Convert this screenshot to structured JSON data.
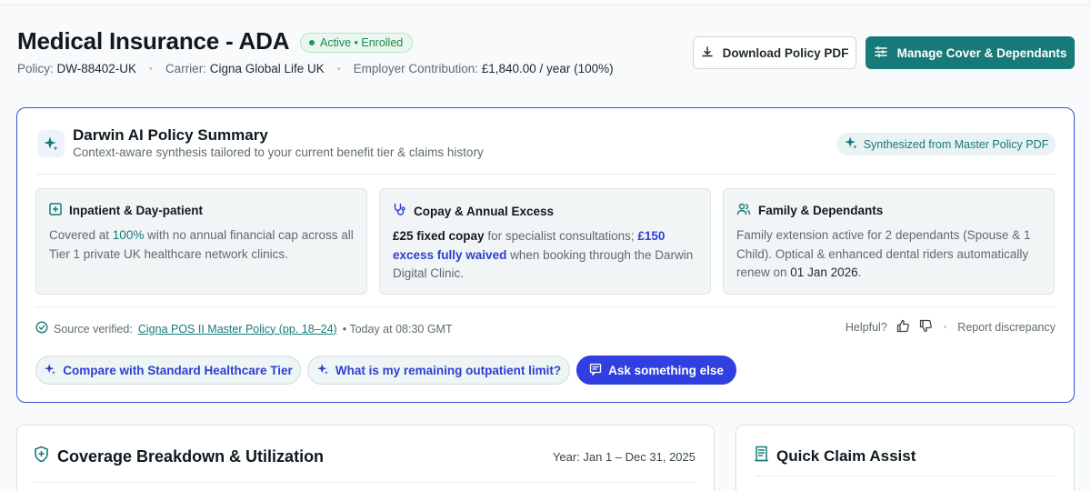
{
  "header": {
    "title": "Medical Insurance - ADA",
    "status": "Active • Enrolled",
    "policy_label": "Policy:",
    "policy_value": "DW-88402-UK",
    "carrier_label": "Carrier:",
    "carrier_value": "Cigna Global Life UK",
    "contribution_label": "Employer Contribution:",
    "contribution_value": "£1,840.00 / year (100%)",
    "download_button": "Download Policy PDF",
    "manage_button": "Manage Cover & Dependants"
  },
  "ai_summary": {
    "title": "Darwin AI Policy Summary",
    "subtitle": "Context-aware synthesis tailored to your current benefit tier & claims history",
    "source_badge": "Synthesized from Master Policy PDF",
    "cards": [
      {
        "title": "Inpatient & Day-patient",
        "icon": "plus-square-icon",
        "text_1": "Covered at ",
        "highlight": "100%",
        "text_2": " with no annual financial cap across all Tier 1 private UK healthcare network clinics."
      },
      {
        "title": "Copay & Annual Excess",
        "icon": "stethoscope-icon",
        "bold": "£25 fixed copay",
        "text_1": " for specialist consultations; ",
        "highlight": "£150 excess fully waived",
        "text_2": " when booking through the Darwin Digital Clinic."
      },
      {
        "title": "Family & Dependants",
        "icon": "users-icon",
        "text_1": "Family extension active for 2 dependants (Spouse & 1 Child). Optical & enhanced dental riders automatically renew on ",
        "date": "01 Jan 2026",
        "text_2": "."
      }
    ],
    "source_label": "Source verified:",
    "source_link": "Cigna POS II Master Policy (pp. 18–24)",
    "source_time": "• Today at 08:30 GMT",
    "helpful_label": "Helpful?",
    "report_label": "Report discrepancy",
    "chips": [
      "Compare with Standard Healthcare Tier",
      "What is my remaining outpatient limit?",
      "Ask something else"
    ]
  },
  "coverage": {
    "title": "Coverage Breakdown & Utilization",
    "year": "Year: Jan 1 – Dec 31, 2025"
  },
  "quick_claim": {
    "title": "Quick Claim Assist"
  },
  "colors": {
    "brand_teal": "#177a78",
    "accent_blue": "#2f3fe0",
    "success_green": "#1e9a55"
  }
}
